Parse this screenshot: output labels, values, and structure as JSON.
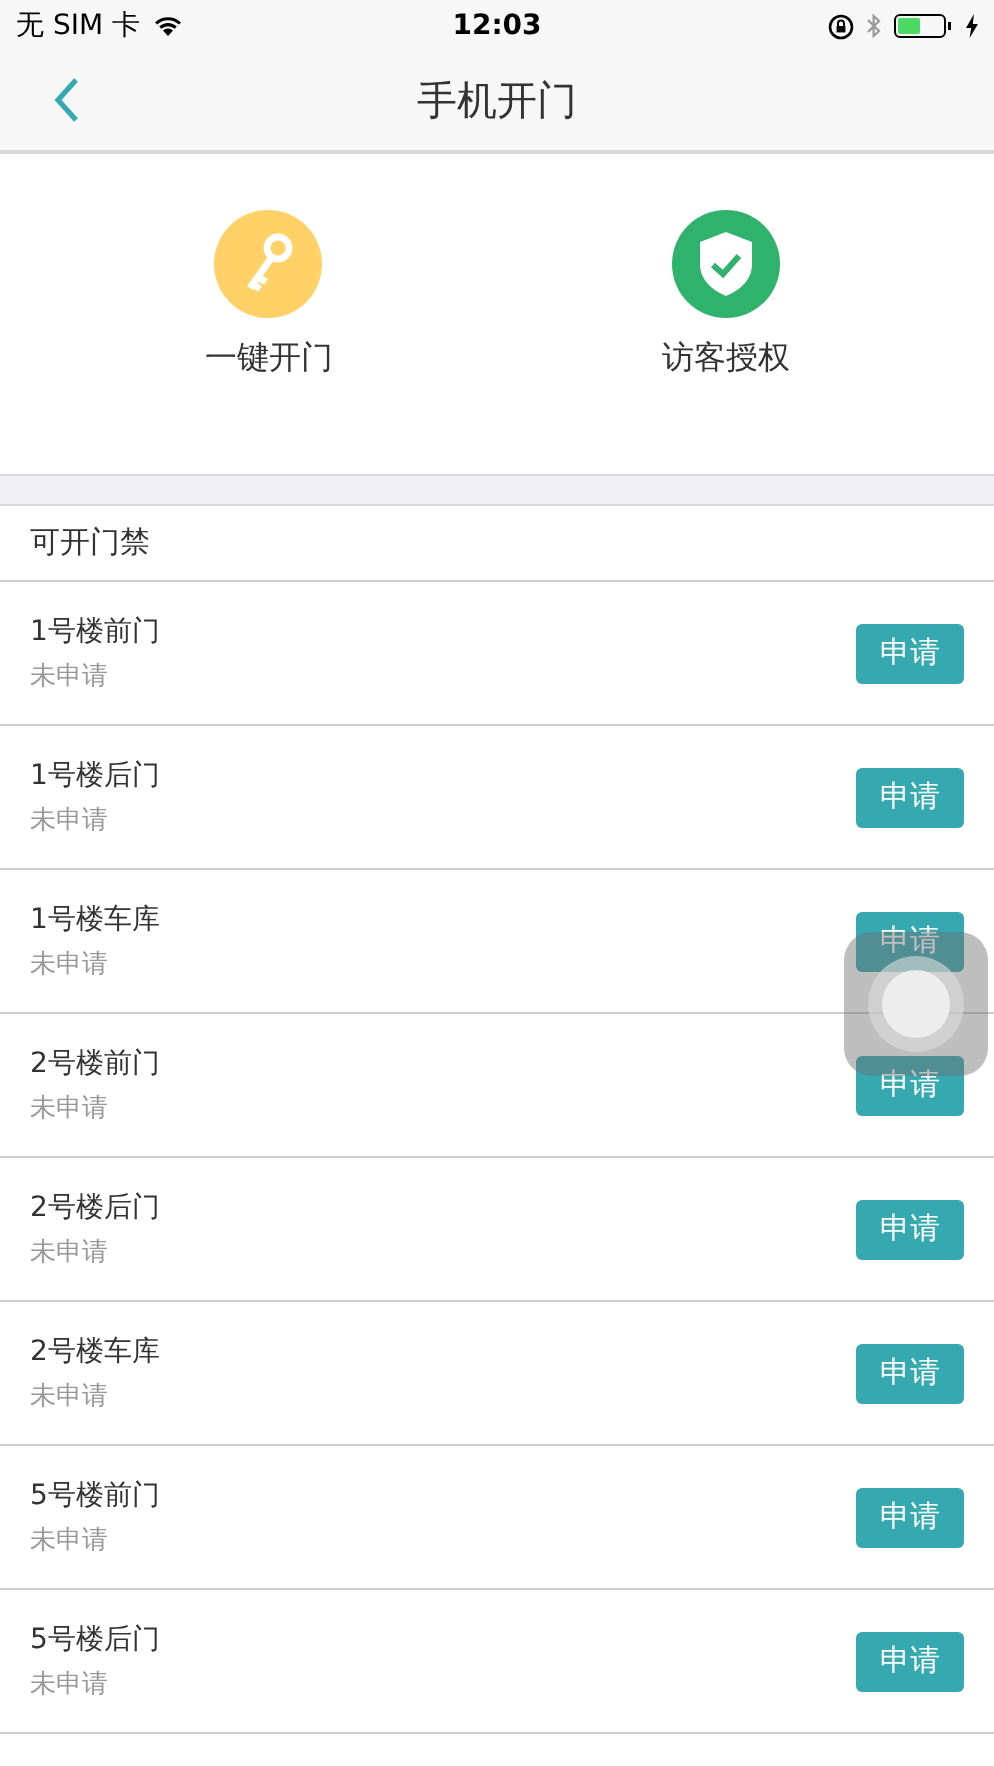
{
  "status_bar": {
    "carrier": "无 SIM 卡",
    "time": "12:03"
  },
  "nav": {
    "title": "手机开门"
  },
  "actions": [
    {
      "label": "一键开门",
      "kind": "key"
    },
    {
      "label": "访客授权",
      "kind": "shield"
    }
  ],
  "section_title": "可开门禁",
  "doors": [
    {
      "name": "1号楼前门",
      "status": "未申请",
      "button": "申请"
    },
    {
      "name": "1号楼后门",
      "status": "未申请",
      "button": "申请"
    },
    {
      "name": "1号楼车库",
      "status": "未申请",
      "button": "申请"
    },
    {
      "name": "2号楼前门",
      "status": "未申请",
      "button": "申请"
    },
    {
      "name": "2号楼后门",
      "status": "未申请",
      "button": "申请"
    },
    {
      "name": "2号楼车库",
      "status": "未申请",
      "button": "申请"
    },
    {
      "name": "5号楼前门",
      "status": "未申请",
      "button": "申请"
    },
    {
      "name": "5号楼后门",
      "status": "未申请",
      "button": "申请"
    }
  ]
}
